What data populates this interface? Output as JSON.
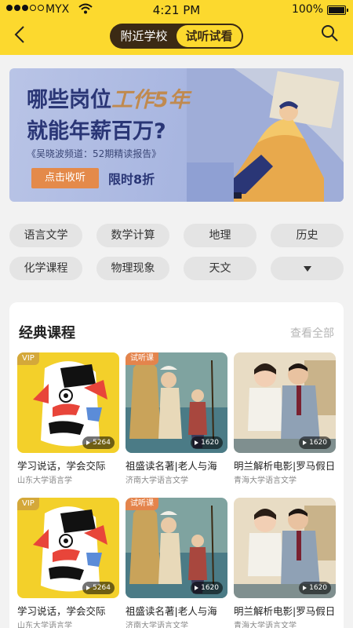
{
  "status_bar": {
    "carrier": "MYX",
    "time": "4:21 PM",
    "battery": "100%"
  },
  "header": {
    "tabs": [
      {
        "label": "附近学校",
        "active": false
      },
      {
        "label": "试听试看",
        "active": true
      }
    ]
  },
  "banner": {
    "line1_a": "哪些岗位",
    "line1_b": "工作5年",
    "line2": "就能年薪百万?",
    "subtitle": "《吴晓波频道：52期精读报告》",
    "cta": "点击收听",
    "offer": "限时8折"
  },
  "categories": [
    "语言文学",
    "数学计算",
    "地理",
    "历史",
    "化学课程",
    "物理现象",
    "天文"
  ],
  "section": {
    "title": "经典课程",
    "more": "查看全部"
  },
  "courses": [
    {
      "badge": "VIP",
      "count": "5264",
      "title": "学习说话，学会交际",
      "school": "山东大学语言学"
    },
    {
      "badge": "试听课",
      "count": "1620",
      "title": "祖盛读名著|老人与海",
      "school": "济南大学语言文学"
    },
    {
      "badge": "",
      "count": "1620",
      "title": "明兰解析电影|罗马假日",
      "school": "青海大学语言文学"
    },
    {
      "badge": "VIP",
      "count": "5264",
      "title": "学习说话，学会交际",
      "school": "山东大学语言学"
    },
    {
      "badge": "试听课",
      "count": "1620",
      "title": "祖盛读名著|老人与海",
      "school": "济南大学语言文学"
    },
    {
      "badge": "",
      "count": "1620",
      "title": "明兰解析电影|罗马假日",
      "school": "青海大学语言文学"
    }
  ],
  "colors": {
    "accent": "#fcd92e",
    "dark": "#3b2a14",
    "cta": "#e48a4a"
  }
}
